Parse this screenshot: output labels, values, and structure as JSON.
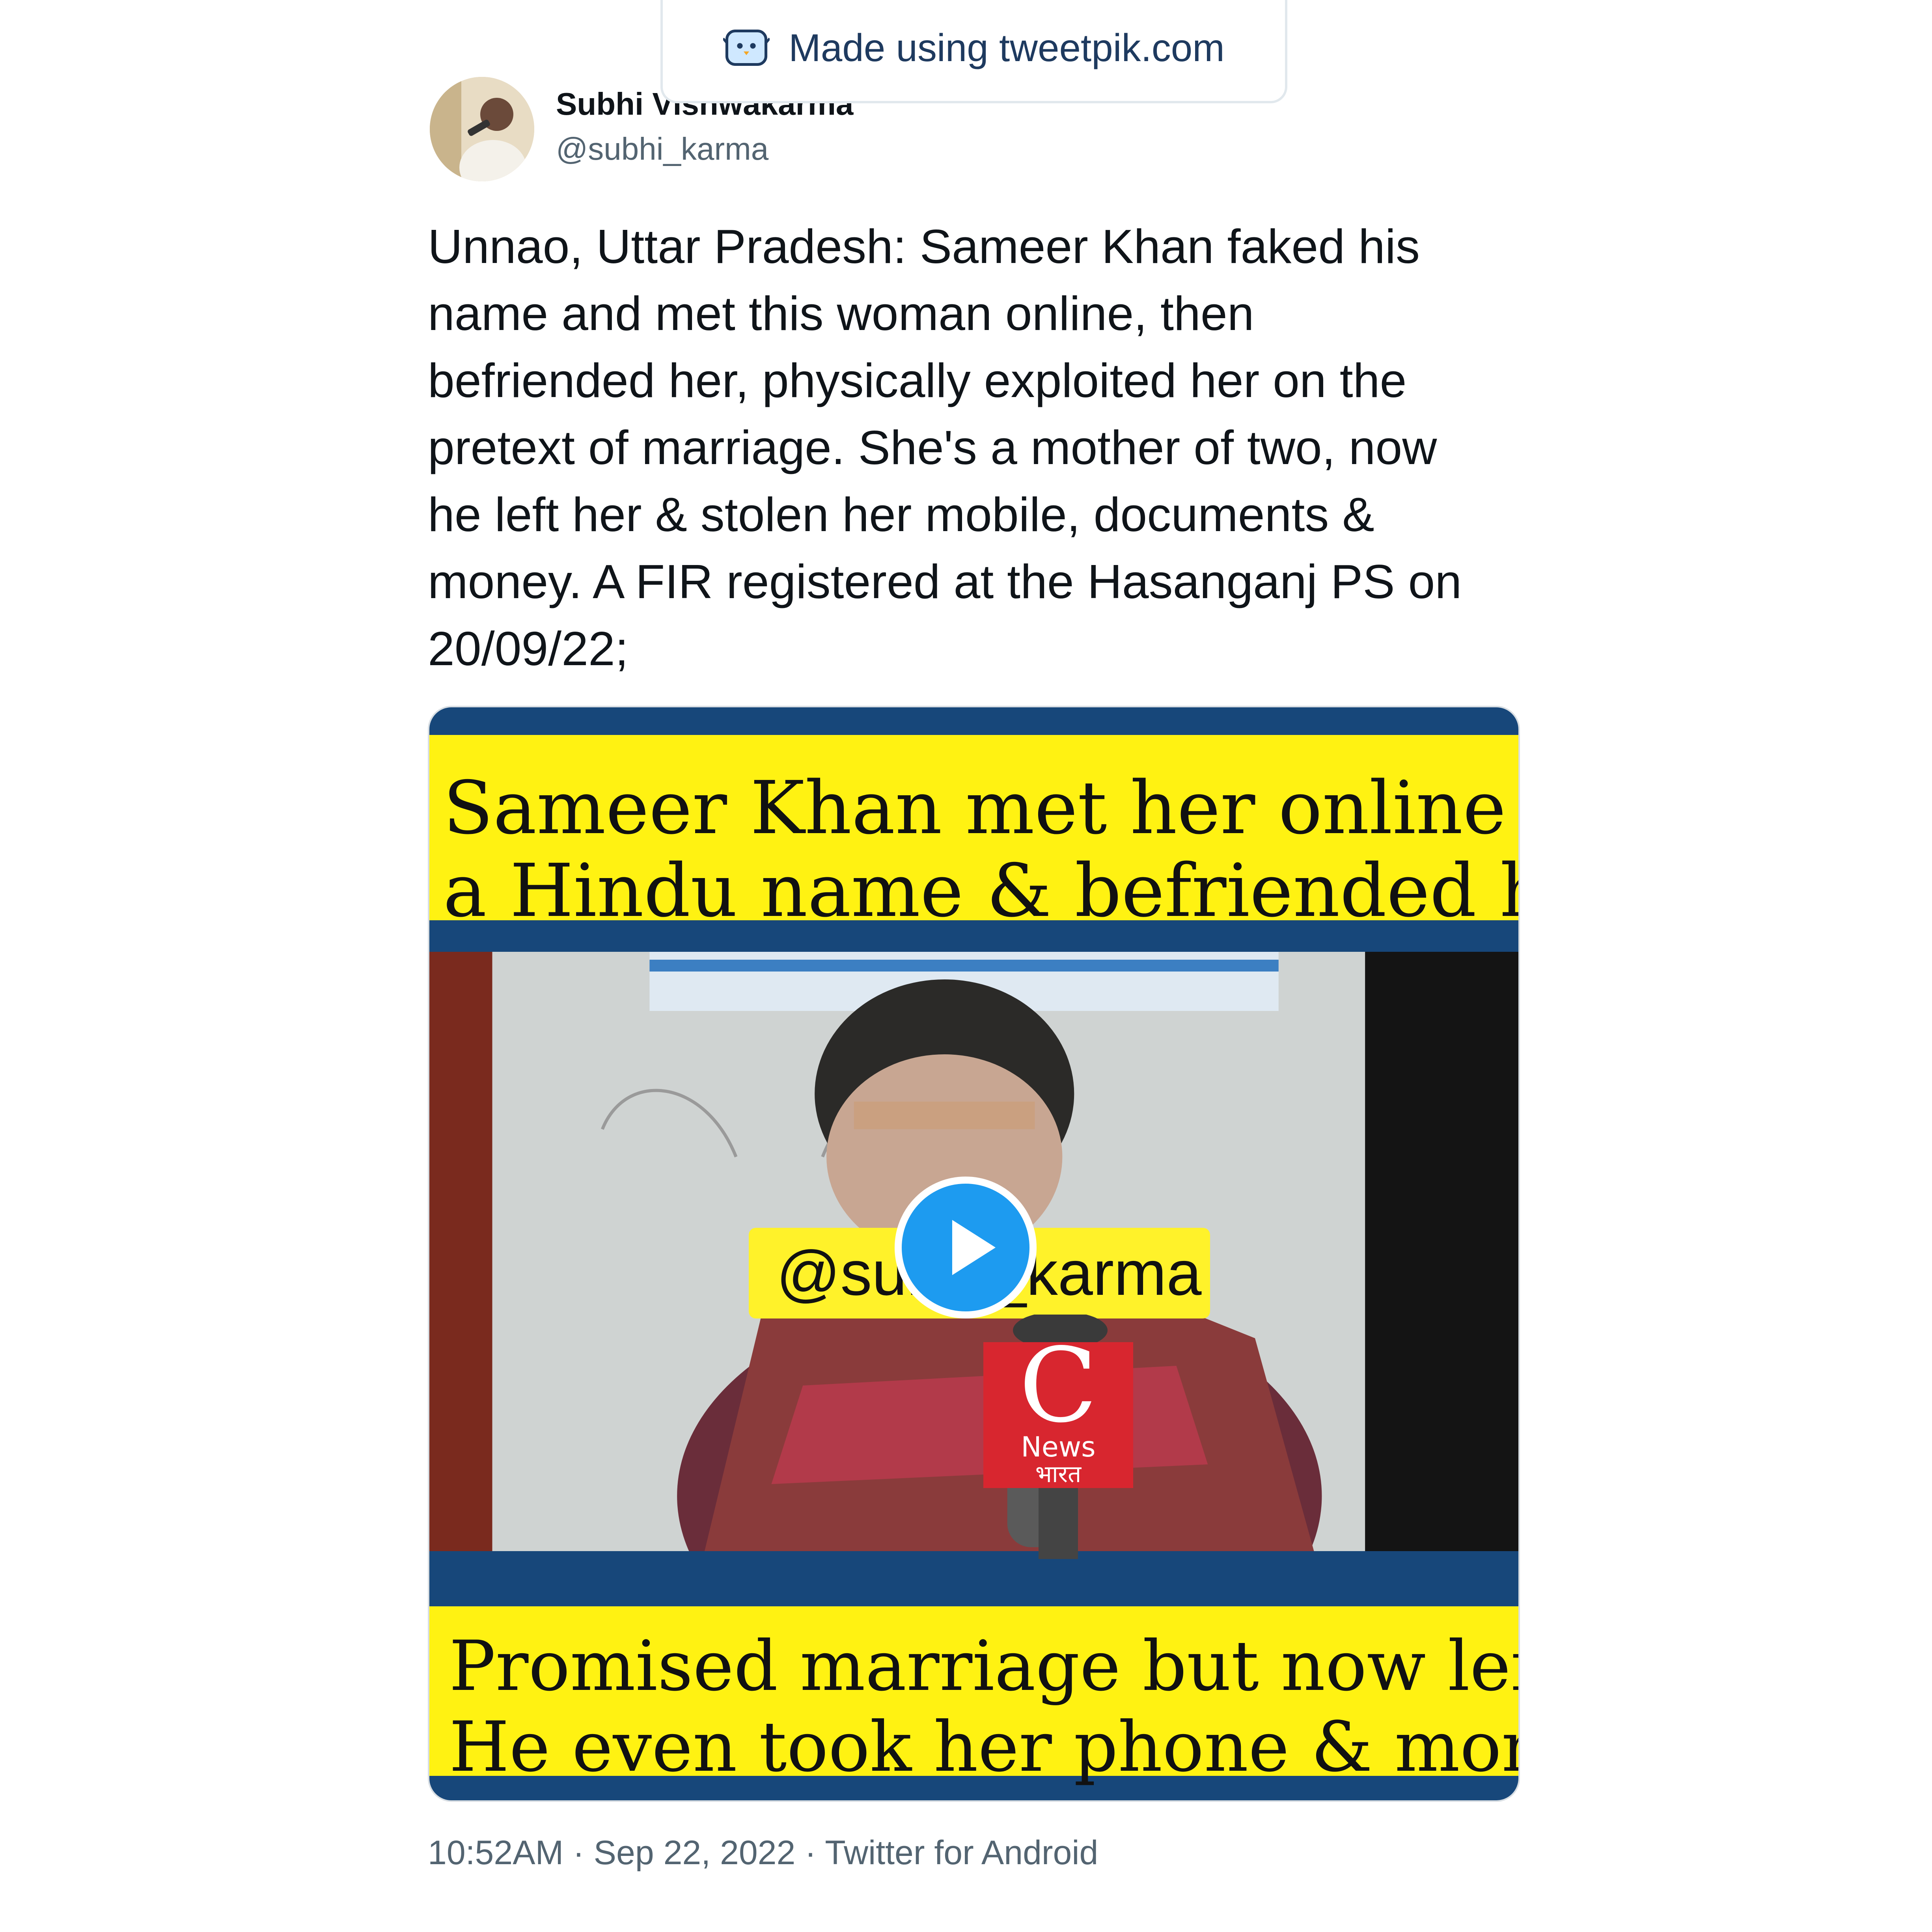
{
  "watermark": {
    "text": "Made using tweetpik.com",
    "icon": "tweetpik-bird-icon"
  },
  "author": {
    "name": "Subhi Vishwakarma",
    "handle": "@subhi_karma",
    "avatar_icon": "profile-photo"
  },
  "tweet": {
    "text": "Unnao, Uttar Pradesh: Sameer Khan faked his\nname and met this woman online, then\nbefriended her, physically exploited her on the\npretext of marriage. She's a mother of two, now\nhe left her & stolen her mobile, documents &\nmoney. A FIR registered at the Hasanganj PS on\n20/09/22;"
  },
  "media": {
    "top_banner": [
      "Sameer Khan met her online with",
      "a Hindu name & befriended her"
    ],
    "bottom_banner": [
      "Promised marriage but now left her,",
      "He even took her phone & money"
    ],
    "watermark_chip": "@subhi_karma",
    "mic_label": [
      "News",
      "भारत"
    ],
    "play_icon": "play-icon"
  },
  "footer": {
    "time": "10:52AM",
    "date": "Sep 22, 2022",
    "source": "Twitter for Android",
    "separator": " · "
  },
  "colors": {
    "banner_yellow": "#fff212",
    "banner_blue": "#17477a",
    "play_blue": "#1d9bf0",
    "muted_text": "#536471"
  }
}
